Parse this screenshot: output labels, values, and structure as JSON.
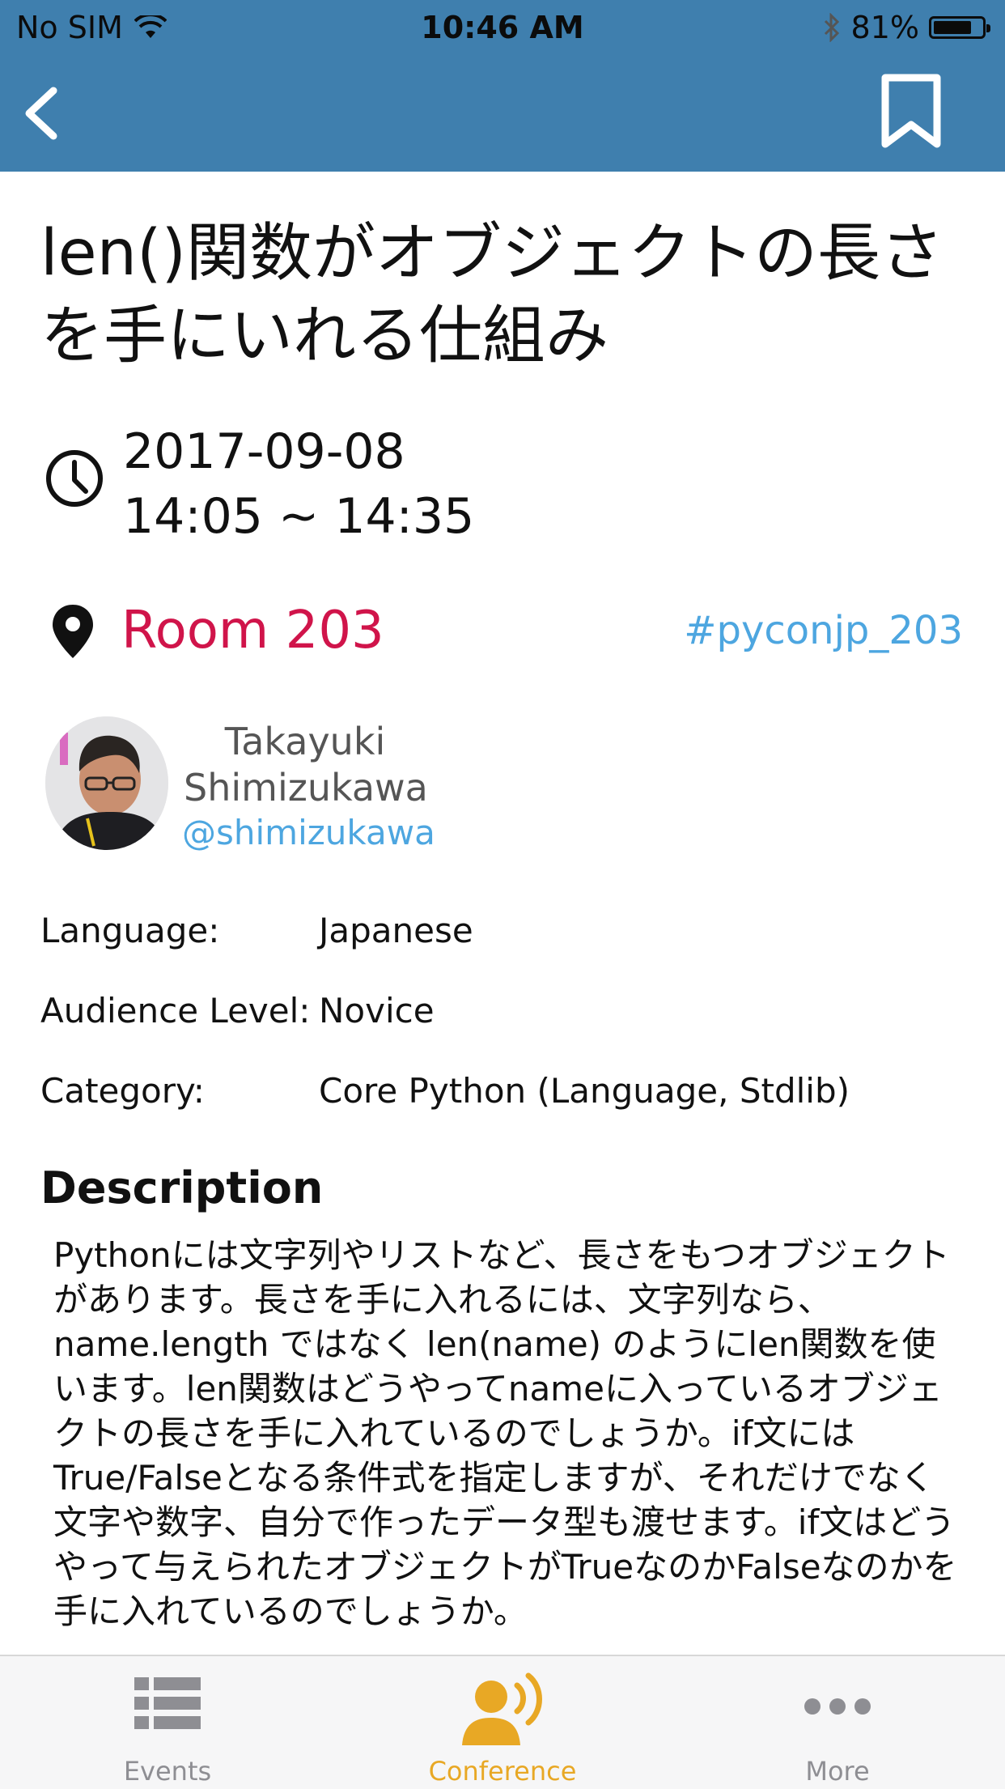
{
  "status_bar": {
    "carrier": "No SIM",
    "time": "10:46 AM",
    "battery_percent": "81%",
    "battery_level": 0.81
  },
  "nav": {
    "back_icon": "chevron-left-icon",
    "bookmark_icon": "bookmark-icon"
  },
  "session": {
    "title": "len()関数がオブジェクトの長さを手にいれる仕組み",
    "date": "2017-09-08",
    "time_range": "14:05 ~ 14:35",
    "room": "Room 203",
    "hashtag": "#pyconjp_203"
  },
  "speaker": {
    "first_name": "Takayuki",
    "last_name": "Shimizukawa",
    "handle": "@shimizukawa"
  },
  "details": [
    {
      "label": "Language:",
      "value": "Japanese"
    },
    {
      "label": "Audience Level:",
      "value": "Novice"
    },
    {
      "label": "Category:",
      "value": "Core Python (Language, Stdlib)"
    }
  ],
  "description": {
    "heading": "Description",
    "text": "Pythonには文字列やリストなど、長さをもつオブジェクトがあります。長さを手に入れるには、文字列なら、name.length ではなく len(name) のようにlen関数を使います。len関数はどうやってnameに入っているオブジェクトの長さを手に入れているのでしょうか。if文にはTrue/Falseとなる条件式を指定しますが、それだけでなく文字や数字、自分で作ったデータ型も渡せます。if文はどうやって与えられたオブジェクトがTrueなのかFalseなのかを手に入れているのでしょうか。"
  },
  "tabbar": {
    "tabs": [
      {
        "label": "Events",
        "icon": "list-icon",
        "active": false
      },
      {
        "label": "Conference",
        "icon": "speaker-icon",
        "active": true
      },
      {
        "label": "More",
        "icon": "more-icon",
        "active": false
      }
    ]
  },
  "colors": {
    "header": "#3f7fae",
    "room": "#d0144a",
    "link": "#4da6e0",
    "active_tab": "#e8a825",
    "inactive_tab": "#8e8e93"
  }
}
